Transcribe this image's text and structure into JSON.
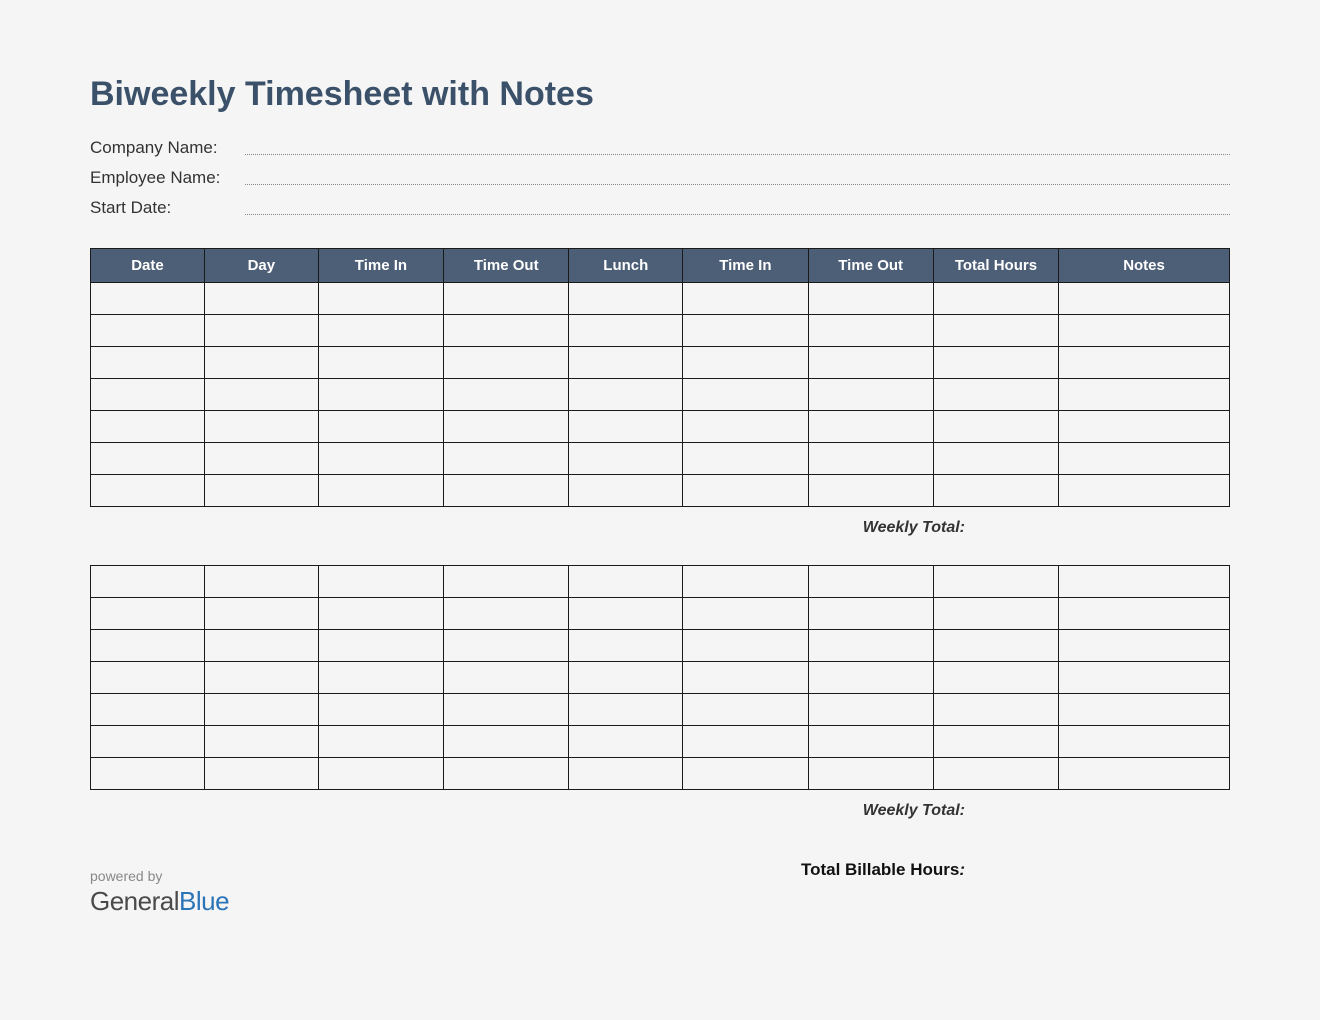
{
  "title": "Biweekly Timesheet with Notes",
  "info": {
    "company_label": "Company Name:",
    "employee_label": "Employee Name:",
    "startdate_label": "Start Date:",
    "company_value": "",
    "employee_value": "",
    "startdate_value": ""
  },
  "columns": [
    "Date",
    "Day",
    "Time In",
    "Time Out",
    "Lunch",
    "Time In",
    "Time Out",
    "Total Hours",
    "Notes"
  ],
  "week1_rows": 7,
  "week2_rows": 7,
  "labels": {
    "weekly_total": "Weekly Total:",
    "billable": "Total Billable Hours",
    "billable_colon": ":"
  },
  "footer": {
    "powered_by": "powered by",
    "brand_part1": "General",
    "brand_part2": "Blue"
  }
}
